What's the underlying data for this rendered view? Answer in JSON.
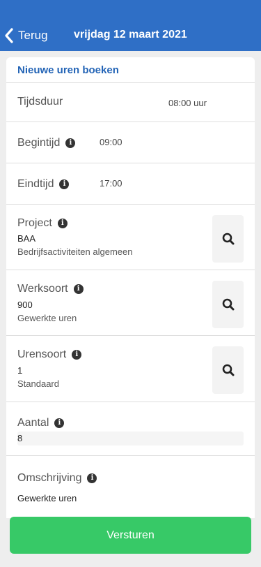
{
  "header": {
    "back_label": "Terug",
    "title": "vrijdag 12 maart 2021",
    "color": "#2f6fc6"
  },
  "form": {
    "title": "Nieuwe uren boeken",
    "tijdsduur": {
      "label": "Tijdsduur",
      "value": "08:00 uur"
    },
    "begintijd": {
      "label": "Begintijd",
      "value": "09:00"
    },
    "eindtijd": {
      "label": "Eindtijd",
      "value": "17:00"
    },
    "project": {
      "label": "Project",
      "code": "BAA",
      "description": "Bedrijfsactiviteiten algemeen"
    },
    "werksoort": {
      "label": "Werksoort",
      "code": "900",
      "description": "Gewerkte uren"
    },
    "urensoort": {
      "label": "Urensoort",
      "code": "1",
      "description": "Standaard"
    },
    "aantal": {
      "label": "Aantal",
      "value": "8"
    },
    "omschrijving": {
      "label": "Omschrijving",
      "value": "Gewerkte uren"
    }
  },
  "icons": {
    "info": "info-icon",
    "search": "search-icon",
    "back": "chevron-left-icon"
  },
  "submit": {
    "label": "Versturen",
    "color": "#37c967"
  }
}
